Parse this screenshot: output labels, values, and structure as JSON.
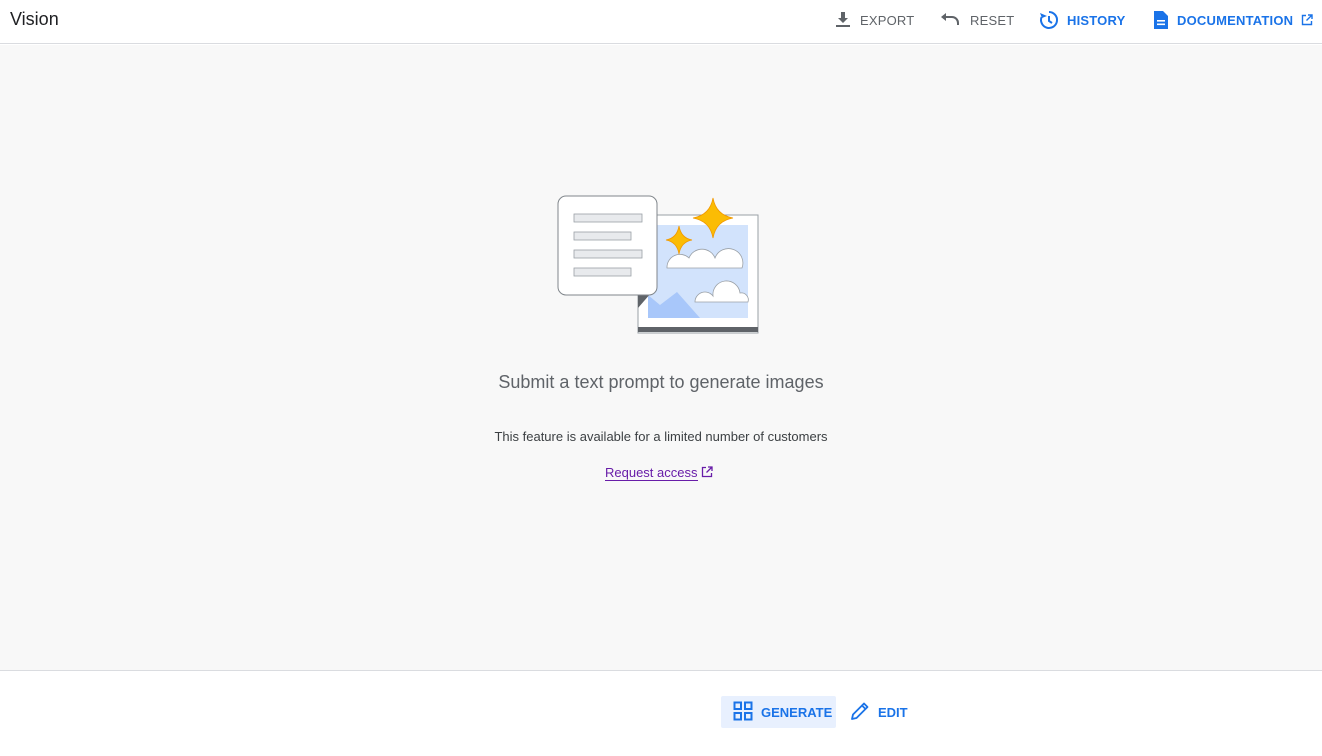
{
  "header": {
    "title": "Vision",
    "actions": {
      "export": {
        "label": "EXPORT",
        "icon": "download-icon"
      },
      "reset": {
        "label": "RESET",
        "icon": "undo-icon"
      },
      "history": {
        "label": "HISTORY",
        "icon": "history-icon"
      },
      "documentation": {
        "label": "DOCUMENTATION",
        "icon": "document-icon",
        "external_icon": "open-in-new-icon"
      }
    }
  },
  "empty_state": {
    "illustration": "text-to-image-illustration",
    "headline": "Submit a text prompt to generate images",
    "subtext": "This feature is available for a limited number of customers",
    "link_label": "Request access",
    "link_icon": "open-in-new-icon"
  },
  "modes": {
    "generate": {
      "label": "GENERATE",
      "icon": "grid-icon",
      "active": true
    },
    "edit": {
      "label": "EDIT",
      "icon": "pencil-icon",
      "active": false
    }
  },
  "colors": {
    "accent": "#1a73e8",
    "accent_bg": "#e8f0fe",
    "grey_text": "#5f6368",
    "link_visited": "#681da8",
    "star": "#fbbc04"
  }
}
